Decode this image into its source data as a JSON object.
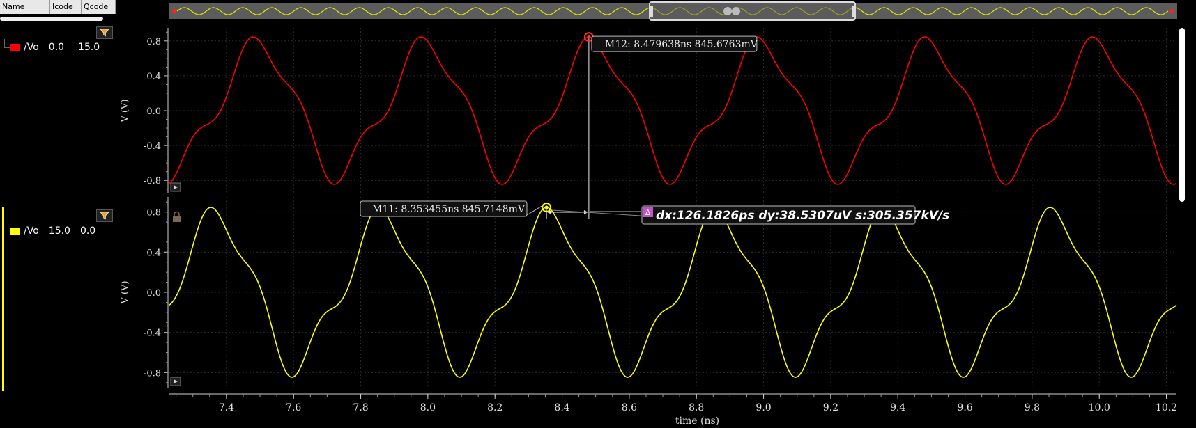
{
  "left_panel": {
    "columns": [
      "Name",
      "Icode",
      "Qcode"
    ],
    "signals": [
      {
        "name": "/Vo",
        "icode": "0.0",
        "qcode": "15.0",
        "color": "#ff0000"
      },
      {
        "name": "/Vo",
        "icode": "15.0",
        "qcode": "0.0",
        "color": "#ffff00"
      }
    ]
  },
  "chart_data": {
    "type": "line",
    "xlabel": "time (ns)",
    "xlim": [
      7.23,
      10.23
    ],
    "xticks": [
      "7.4",
      "7.6",
      "7.8",
      "8.0",
      "8.2",
      "8.4",
      "8.6",
      "8.8",
      "9.0",
      "9.2",
      "9.4",
      "9.6",
      "9.8",
      "10.0",
      "10.2"
    ],
    "xtick_values": [
      7.4,
      7.6,
      7.8,
      8.0,
      8.2,
      8.4,
      8.6,
      8.8,
      9.0,
      9.2,
      9.4,
      9.6,
      9.8,
      10.0,
      10.2
    ],
    "grid": true,
    "period_ns": 0.5,
    "strips": [
      {
        "ylabel": "V (V)",
        "ylim": [
          -0.95,
          0.95
        ],
        "yticks": [
          "0.8",
          "0.4",
          "0.0",
          "-0.4",
          "-0.8"
        ],
        "ytick_values": [
          0.8,
          0.4,
          0.0,
          -0.4,
          -0.8
        ],
        "series": [
          {
            "color": "#ff0000",
            "peak_time_ns": 8.479638,
            "amplitude": 0.8457
          }
        ]
      },
      {
        "ylabel": "V (V)",
        "ylim": [
          -0.95,
          0.95
        ],
        "yticks": [
          "0.8",
          "0.4",
          "0.0",
          "-0.4",
          "-0.8"
        ],
        "ytick_values": [
          0.8,
          0.4,
          0.0,
          -0.4,
          -0.8
        ],
        "series": [
          {
            "color": "#ffff00",
            "peak_time_ns": 8.353455,
            "amplitude": 0.8457
          }
        ]
      }
    ],
    "markers": [
      {
        "id": "M12",
        "label": "M12: 8.479638ns 845.6763mV",
        "x": 8.479638,
        "y": 0.8456763,
        "strip": 0,
        "color": "#ff3030"
      },
      {
        "id": "M11",
        "label": "M11: 8.353455ns 845.7148mV",
        "x": 8.353455,
        "y": 0.8457148,
        "strip": 1,
        "color": "#ffff00"
      }
    ],
    "delta": {
      "icon": "delta-icon",
      "label": "dx:126.1826ps dy:38.5307uV s:305.357kV/s"
    }
  }
}
